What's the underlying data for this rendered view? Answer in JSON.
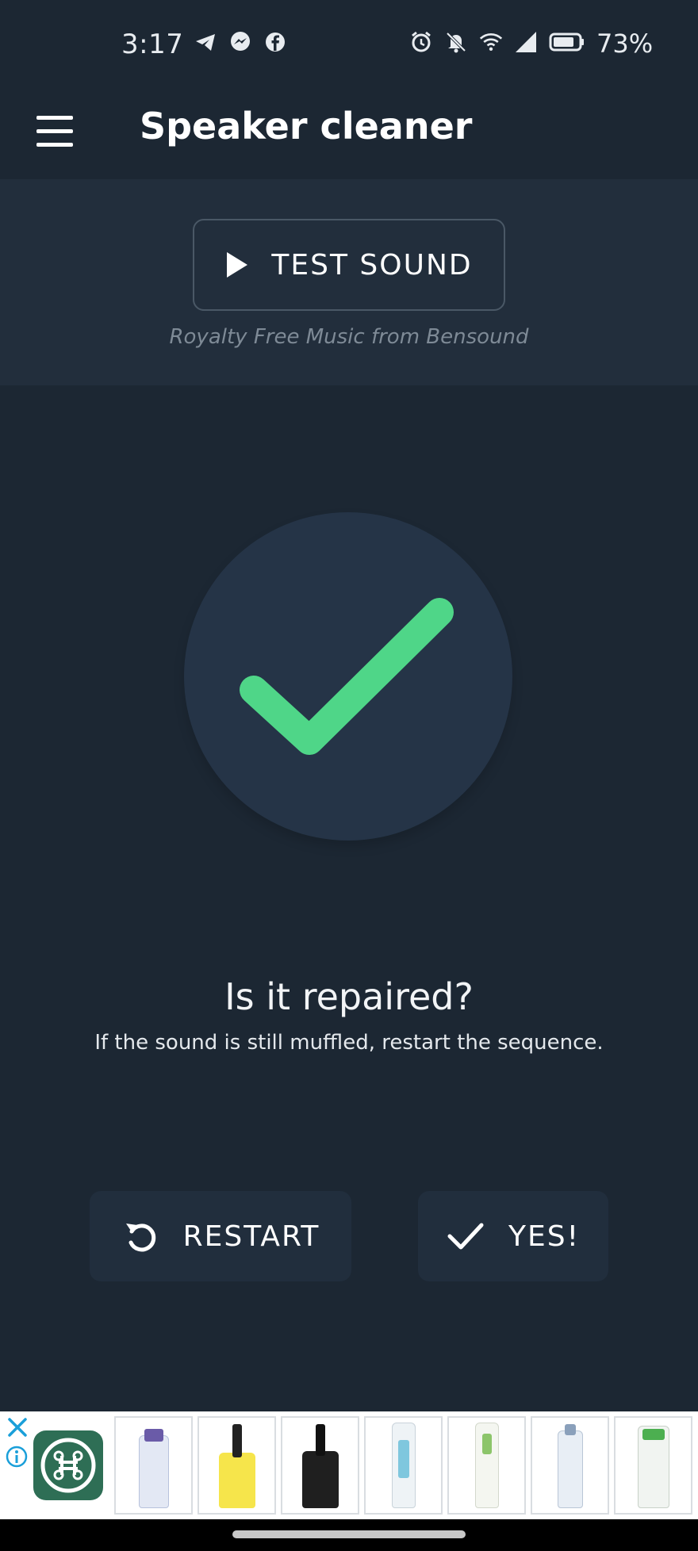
{
  "status_bar": {
    "time": "3:17",
    "left_icons": [
      "telegram-icon",
      "messenger-icon",
      "facebook-icon"
    ],
    "right_icons": [
      "alarm-icon",
      "muted-bell-icon",
      "wifi-icon",
      "signal-icon",
      "battery-icon"
    ],
    "battery_percent": "73%"
  },
  "toolbar": {
    "title": "Speaker cleaner",
    "menu_icon": "hamburger-menu-icon"
  },
  "test_panel": {
    "button_label": "TEST SOUND",
    "button_icon": "play-icon",
    "credit": "Royalty Free Music from Bensound"
  },
  "result": {
    "icon": "checkmark-icon",
    "check_color": "#4fd688",
    "question": "Is it repaired?",
    "hint": "If the sound is still muffled, restart the sequence."
  },
  "actions": {
    "restart_label": "RESTART",
    "restart_icon": "restart-icon",
    "yes_label": "YES!",
    "yes_icon": "check-icon"
  },
  "ad": {
    "close_icon": "close-icon",
    "info_icon": "info-icon",
    "logo_icon": "command-key-icon",
    "product_count": 7
  },
  "colors": {
    "background": "#1c2733",
    "panel": "#222e3c",
    "accent_green": "#4fd688"
  }
}
